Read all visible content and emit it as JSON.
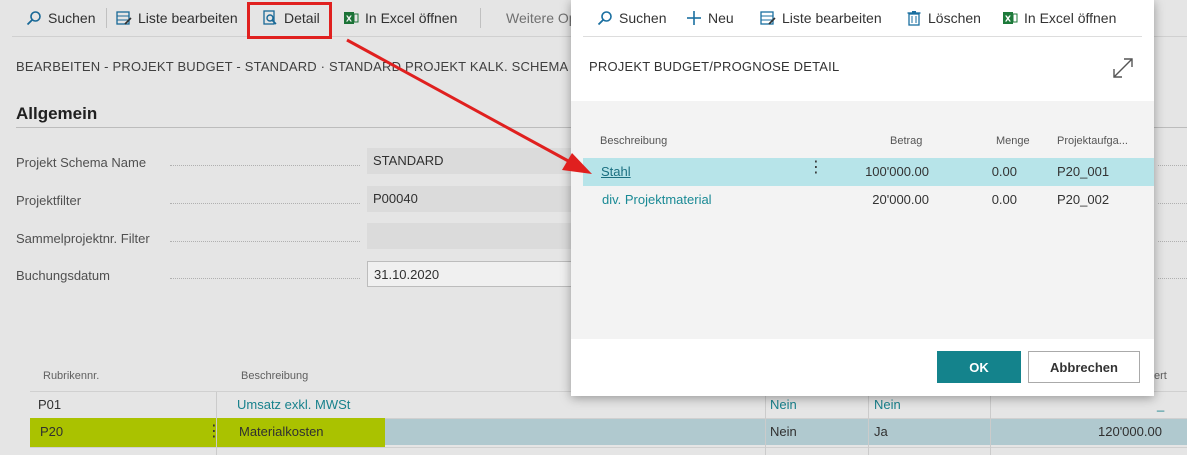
{
  "background": {
    "toolbar": {
      "search": "Suchen",
      "edit_list": "Liste bearbeiten",
      "detail": "Detail",
      "excel": "In Excel öffnen",
      "more": "Weitere Op"
    },
    "breadcrumb": "BEARBEITEN - PROJEKT BUDGET - STANDARD · STANDARD PROJEKT KALK. SCHEMA",
    "section_title": "Allgemein",
    "fields": [
      {
        "label": "Projekt Schema Name",
        "value": "STANDARD"
      },
      {
        "label": "Projektfilter",
        "value": "P00040"
      },
      {
        "label": "Sammelprojektnr. Filter",
        "value": ""
      },
      {
        "label": "Buchungsdatum",
        "value": "31.10.2020"
      }
    ],
    "grid": {
      "headers": {
        "code": "Rubrikennr.",
        "description": "Beschreibung",
        "value_short": "ert"
      },
      "rows": [
        {
          "code": "P01",
          "description": "Umsatz exkl. MWSt",
          "c1": "Nein",
          "c2": "Nein",
          "amount": "_"
        },
        {
          "code": "P20",
          "description": "Materialkosten",
          "c1": "Nein",
          "c2": "Ja",
          "amount": "120'000.00"
        }
      ]
    }
  },
  "dialog": {
    "toolbar": {
      "search": "Suchen",
      "new": "Neu",
      "edit_list": "Liste bearbeiten",
      "delete": "Löschen",
      "excel": "In Excel öffnen"
    },
    "title": "PROJEKT BUDGET/PROGNOSE DETAIL",
    "table": {
      "headers": {
        "description": "Beschreibung",
        "amount": "Betrag",
        "quantity": "Menge",
        "task": "Projektaufga..."
      },
      "rows": [
        {
          "description": "Stahl",
          "amount": "100'000.00",
          "quantity": "0.00",
          "task": "P20_001"
        },
        {
          "description": "div. Projektmaterial",
          "amount": "20'000.00",
          "quantity": "0.00",
          "task": "P20_002"
        }
      ]
    },
    "buttons": {
      "ok": "OK",
      "cancel": "Abbrechen"
    }
  },
  "colors": {
    "accent": "#14838c",
    "link": "#1a8a95",
    "annotation": "#e0201f",
    "highlight": "#b5cf00"
  }
}
